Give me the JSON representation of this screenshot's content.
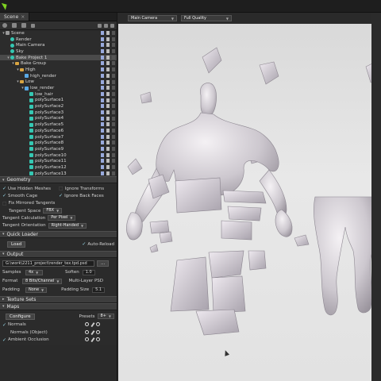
{
  "app": {
    "logo_color": "#7ed321"
  },
  "scene_tab": {
    "label": "Scene",
    "close": "×"
  },
  "tree": [
    {
      "label": "Scene",
      "icon": "gray",
      "indent": 0,
      "exp": "▾"
    },
    {
      "label": "Render",
      "icon": "teal",
      "indent": 1,
      "exp": ""
    },
    {
      "label": "Main Camera",
      "icon": "teal",
      "indent": 1,
      "exp": ""
    },
    {
      "label": "Sky",
      "icon": "teal",
      "indent": 1,
      "exp": ""
    },
    {
      "label": "Bake Project 1",
      "icon": "teal",
      "indent": 1,
      "exp": "▾",
      "selected": true
    },
    {
      "label": "Bake Group",
      "icon": "folder",
      "indent": 2,
      "exp": "▾"
    },
    {
      "label": "High",
      "icon": "folder",
      "indent": 3,
      "exp": "▾"
    },
    {
      "label": "high_render",
      "icon": "blue",
      "indent": 4,
      "exp": ""
    },
    {
      "label": "Low",
      "icon": "folder",
      "indent": 3,
      "exp": "▾"
    },
    {
      "label": "low_render",
      "icon": "blue",
      "indent": 4,
      "exp": "▾"
    },
    {
      "label": "low_hair",
      "icon": "teal-sq",
      "indent": 5,
      "exp": ""
    },
    {
      "label": "polySurface1",
      "icon": "teal-sq",
      "indent": 5,
      "exp": ""
    },
    {
      "label": "polySurface2",
      "icon": "teal-sq",
      "indent": 5,
      "exp": ""
    },
    {
      "label": "polySurface3",
      "icon": "teal-sq",
      "indent": 5,
      "exp": ""
    },
    {
      "label": "polySurface4",
      "icon": "teal-sq",
      "indent": 5,
      "exp": ""
    },
    {
      "label": "polySurface5",
      "icon": "teal-sq",
      "indent": 5,
      "exp": ""
    },
    {
      "label": "polySurface6",
      "icon": "teal-sq",
      "indent": 5,
      "exp": ""
    },
    {
      "label": "polySurface7",
      "icon": "teal-sq",
      "indent": 5,
      "exp": ""
    },
    {
      "label": "polySurface8",
      "icon": "teal-sq",
      "indent": 5,
      "exp": ""
    },
    {
      "label": "polySurface9",
      "icon": "teal-sq",
      "indent": 5,
      "exp": ""
    },
    {
      "label": "polySurface10",
      "icon": "teal-sq",
      "indent": 5,
      "exp": ""
    },
    {
      "label": "polySurface11",
      "icon": "teal-sq",
      "indent": 5,
      "exp": ""
    },
    {
      "label": "polySurface12",
      "icon": "teal-sq",
      "indent": 5,
      "exp": ""
    },
    {
      "label": "polySurface13",
      "icon": "teal-sq",
      "indent": 5,
      "exp": ""
    }
  ],
  "geometry": {
    "header": "Geometry",
    "use_hidden_meshes": "Use Hidden Meshes",
    "ignore_transforms": "Ignore Transforms",
    "smooth_cage": "Smooth Cage",
    "ignore_back_faces": "Ignore Back Faces",
    "fix_mirrored_tangents": "Fix Mirrored Tangents",
    "tangent_space_label": "Tangent Space",
    "tangent_space_value": "FBX",
    "tangent_calc_label": "Tangent Calculation",
    "tangent_calc_value": "Per Pixel",
    "tangent_orient_label": "Tangent Orientation",
    "tangent_orient_value": "Right-Handed"
  },
  "quick_loader": {
    "header": "Quick Loader",
    "load_button": "Load",
    "auto_reload": "Auto-Reload"
  },
  "output": {
    "header": "Output",
    "path": "G:\\work\\2211_project\\render_tex.tpd.psd",
    "browse": "...",
    "samples_label": "Samples",
    "samples_value": "4x",
    "soften_label": "Soften",
    "soften_value": "1.0",
    "format_label": "Format",
    "format_value": "8 Bits/Channel",
    "multi_layer": "Multi-Layer PSD",
    "padding_label": "Padding",
    "padding_value": "None",
    "padding_size_label": "Padding Size",
    "padding_size_value": "5.1"
  },
  "texture_sets": {
    "header": "Texture Sets"
  },
  "maps": {
    "header": "Maps",
    "configure_button": "Configure",
    "presets_label": "Presets",
    "presets_value": "8+",
    "items": [
      {
        "label": "Normals",
        "indent": 0
      },
      {
        "label": "Normals (Object)",
        "indent": 1
      },
      {
        "label": "Ambient Occlusion",
        "indent": 0
      }
    ]
  },
  "viewport": {
    "camera": "Main Camera",
    "quality": "Full Quality"
  }
}
